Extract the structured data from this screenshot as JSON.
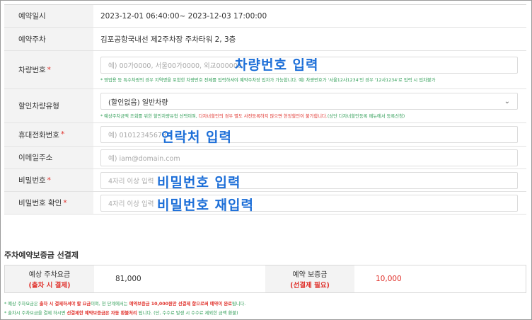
{
  "form": {
    "reservation_date": {
      "label": "예약일시",
      "value": "2023-12-01 06:40:00~ 2023-12-03 17:00:00"
    },
    "parking_lot": {
      "label": "예약주차",
      "value": "김포공항국내선 제2주차장 주차타워 2, 3층"
    },
    "car_number": {
      "label": "차량번호",
      "required": "*",
      "placeholder": "예) 00가0000, 서울00가0000, 외교000000",
      "hint": "* 영업용 등 특수차량의 경우 지역명을 포함한 차량번호 전체를 입력하셔야 예약주차장 입차가 가능합니다. 예) 차량번호가 '서울12사1234'인 경우 '12사1234'로 입력 시 입차불가",
      "annotation": "차량번호 입력"
    },
    "discount_type": {
      "label": "할인차량유형",
      "selected": "(할인없음) 일반차량",
      "hint_prefix": "* 예상주차금액 조회를 위한 할인차량유형 선택이며, ",
      "hint_red": "다자녀할인의 경우 별도 사전등록하지 않으면 현장할인이 불가합니다.",
      "hint_suffix": "(상단 다자녀할인등록 메뉴에서 등록신청)"
    },
    "phone": {
      "label": "휴대전화번호",
      "required": "*",
      "placeholder": "예) 01012345678",
      "annotation": "연락처 입력"
    },
    "email": {
      "label": "이메일주소",
      "placeholder": "예) iam@domain.com"
    },
    "password": {
      "label": "비밀번호",
      "required": "*",
      "placeholder": "4자리 이상 입력",
      "annotation": "비밀번호 입력"
    },
    "password_confirm": {
      "label": "비밀번호 확인",
      "required": "*",
      "placeholder": "4자리 이상 입력",
      "annotation": "비밀번호 재입력"
    }
  },
  "deposit": {
    "title": "주차예약보증금 선결제",
    "expected_fee_label": "예상 주차요금",
    "expected_fee_sub": "(출차 시 결제)",
    "expected_fee_value": "81,000",
    "deposit_label": "예약 보증금",
    "deposit_sub": "(선결제 필요)",
    "deposit_value": "10,000"
  },
  "notes": {
    "n1_a": "* 예상 주차요금은 ",
    "n1_b": "출차 시 결제하셔야 할 요금",
    "n1_c": "이며, 현 단계에서는 ",
    "n1_d": "예약보증금 10,000원만 선결제 함으로써 예약이 완료",
    "n1_e": "됩니다.",
    "n2_a": "* 출차시 주차요금을 결제 하시면 ",
    "n2_b": "선결제한 예약보증금은 자동 환불처리",
    "n2_c": " 됩니다. (단, 수수료 발생 시 수수료 제외한 금액 환불)"
  },
  "colors": {
    "annotation": "#1d6fd8",
    "required": "#e0312b",
    "hint": "#2e9d55"
  }
}
